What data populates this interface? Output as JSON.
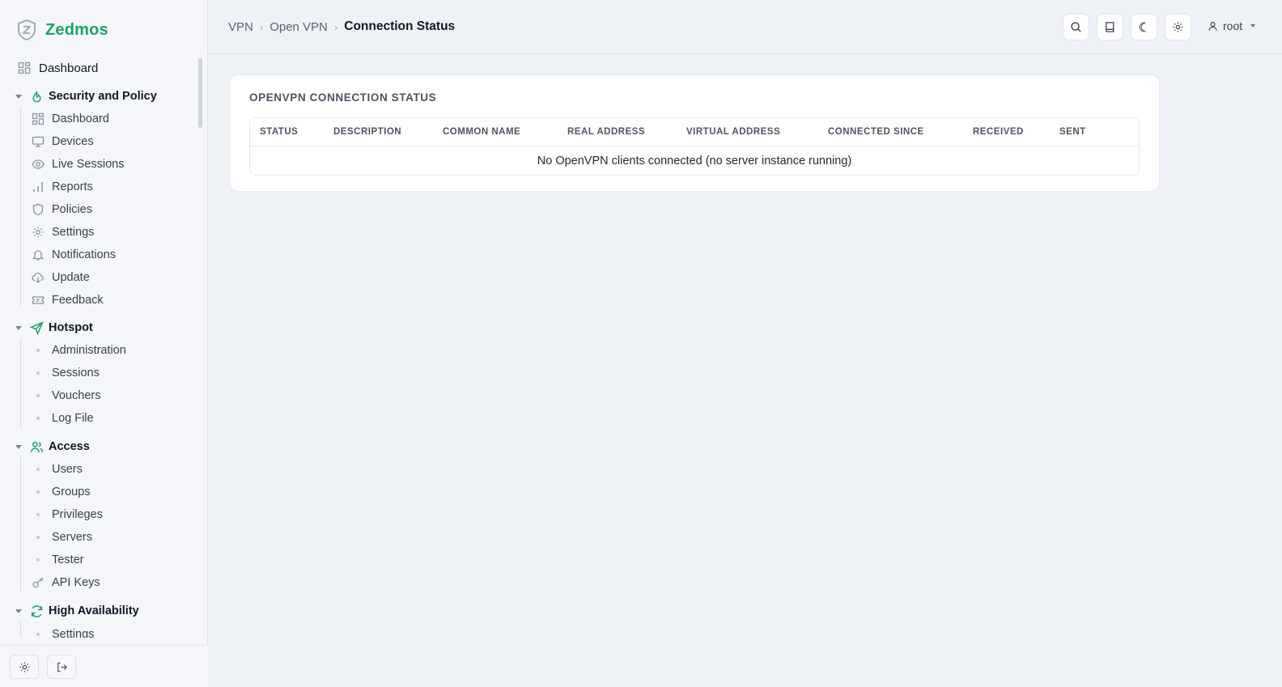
{
  "brand": {
    "name": "Zedmos"
  },
  "sidebar": {
    "dashboard_label": "Dashboard",
    "groups": [
      {
        "label": "Security and Policy",
        "items": [
          "Dashboard",
          "Devices",
          "Live Sessions",
          "Reports",
          "Policies",
          "Settings",
          "Notifications",
          "Update",
          "Feedback"
        ]
      },
      {
        "label": "Hotspot",
        "items": [
          "Administration",
          "Sessions",
          "Vouchers",
          "Log File"
        ]
      },
      {
        "label": "Access",
        "items": [
          "Users",
          "Groups",
          "Privileges",
          "Servers",
          "Tester",
          "API Keys"
        ]
      },
      {
        "label": "High Availability",
        "items": [
          "Settings"
        ]
      }
    ]
  },
  "breadcrumb": {
    "level1": "VPN",
    "level2": "Open VPN",
    "current": "Connection Status"
  },
  "header": {
    "user": "root"
  },
  "card": {
    "title": "OPENVPN CONNECTION STATUS",
    "columns": [
      "STATUS",
      "DESCRIPTION",
      "COMMON NAME",
      "REAL ADDRESS",
      "VIRTUAL ADDRESS",
      "CONNECTED SINCE",
      "RECEIVED",
      "SENT"
    ],
    "empty_message": "No OpenVPN clients connected (no server instance running)"
  },
  "colors": {
    "accent": "#1aa36b",
    "background": "#eef1f6",
    "sidebar": "#f4f6f9"
  }
}
